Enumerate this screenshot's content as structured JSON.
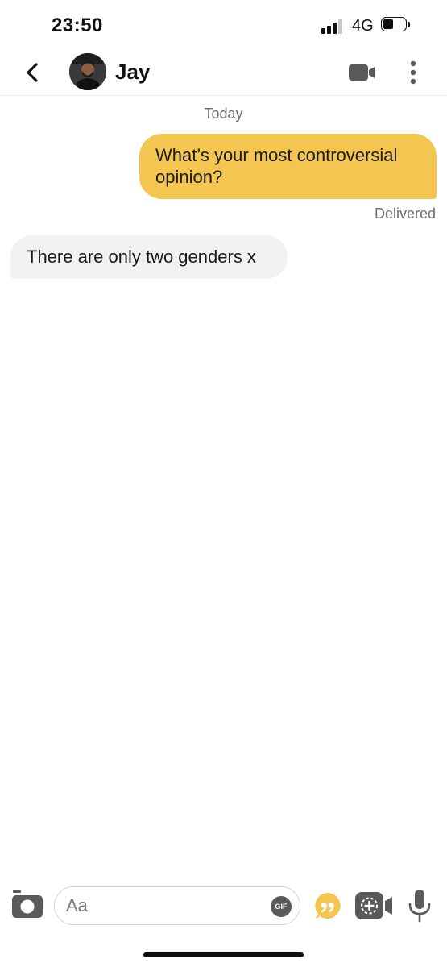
{
  "status_bar": {
    "time": "23:50",
    "network": "4G",
    "signal_bars": 3,
    "battery_level": 0.45
  },
  "header": {
    "back_icon": "chevron-left-icon",
    "contact_name": "Jay",
    "video_icon": "video-camera-icon",
    "more_icon": "more-vertical-icon"
  },
  "chat": {
    "day_label": "Today",
    "messages": [
      {
        "direction": "outgoing",
        "text": "What’s your most controversial opinion?",
        "status": "Delivered"
      },
      {
        "direction": "incoming",
        "text": "There are only two genders x"
      }
    ]
  },
  "composer": {
    "placeholder": "Aa",
    "value": "",
    "gif_label": "GIF",
    "camera_icon": "camera-icon",
    "quote_icon": "quote-bubble-icon",
    "add_video_icon": "add-video-icon",
    "mic_icon": "microphone-icon"
  },
  "colors": {
    "accent": "#f5c64f",
    "incoming_bubble": "#f2f2f2",
    "muted_text": "#6d6d6d"
  }
}
